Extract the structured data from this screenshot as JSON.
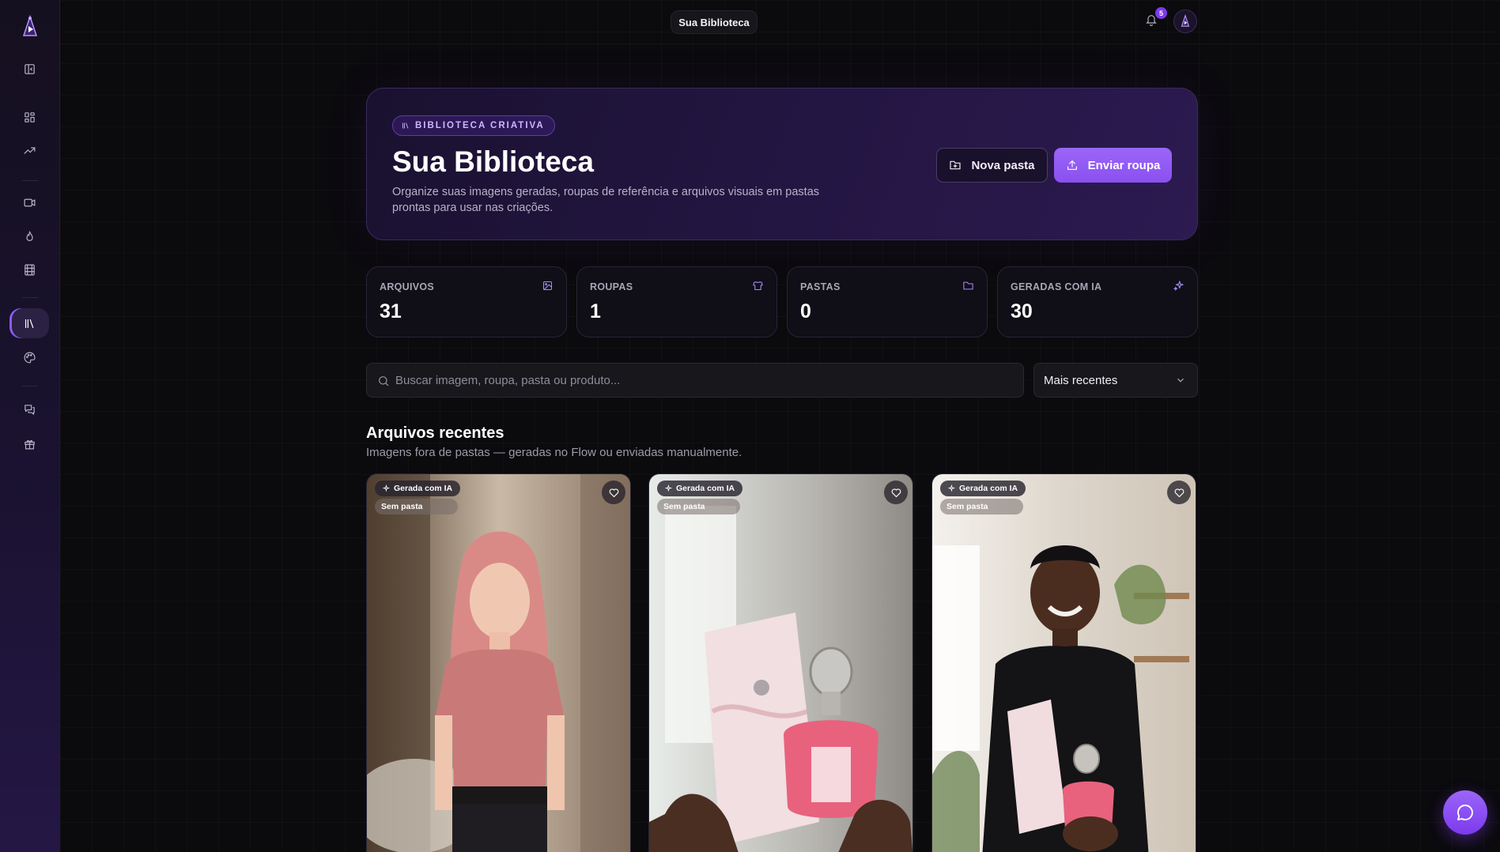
{
  "topbar": {
    "title": "Sua Biblioteca",
    "notification_count": "5"
  },
  "sidebar": {
    "items": [
      {
        "icon": "panel-left-icon"
      },
      {
        "icon": "dashboard-icon"
      },
      {
        "icon": "trending-up-icon"
      },
      {
        "icon": "video-icon"
      },
      {
        "icon": "flame-icon"
      },
      {
        "icon": "film-icon"
      },
      {
        "icon": "library-icon",
        "active": true
      },
      {
        "icon": "palette-icon"
      },
      {
        "icon": "messages-icon"
      },
      {
        "icon": "gift-icon"
      }
    ]
  },
  "hero": {
    "badge": "BIBLIOTECA CRIATIVA",
    "title": "Sua Biblioteca",
    "description": "Organize suas imagens geradas, roupas de referência e arquivos visuais em pastas prontas para usar nas criações.",
    "new_folder_label": "Nova pasta",
    "upload_label": "Enviar roupa"
  },
  "stats": [
    {
      "label": "ARQUIVOS",
      "value": "31",
      "icon": "image-icon"
    },
    {
      "label": "ROUPAS",
      "value": "1",
      "icon": "shirt-icon"
    },
    {
      "label": "PASTAS",
      "value": "0",
      "icon": "folder-icon"
    },
    {
      "label": "GERADAS COM IA",
      "value": "30",
      "icon": "sparkles-icon"
    }
  ],
  "search": {
    "placeholder": "Buscar imagem, roupa, pasta ou produto..."
  },
  "sort": {
    "selected": "Mais recentes"
  },
  "recent": {
    "title": "Arquivos recentes",
    "subtitle": "Imagens fora de pastas — geradas no Flow ou enviadas manualmente.",
    "cards": [
      {
        "tag": "Gerada com IA",
        "folder": "Sem pasta"
      },
      {
        "tag": "Gerada com IA",
        "folder": "Sem pasta"
      },
      {
        "tag": "Gerada com IA",
        "folder": "Sem pasta"
      }
    ]
  },
  "colors": {
    "accent": "#8b5cf6",
    "background": "#0b0a0d"
  }
}
